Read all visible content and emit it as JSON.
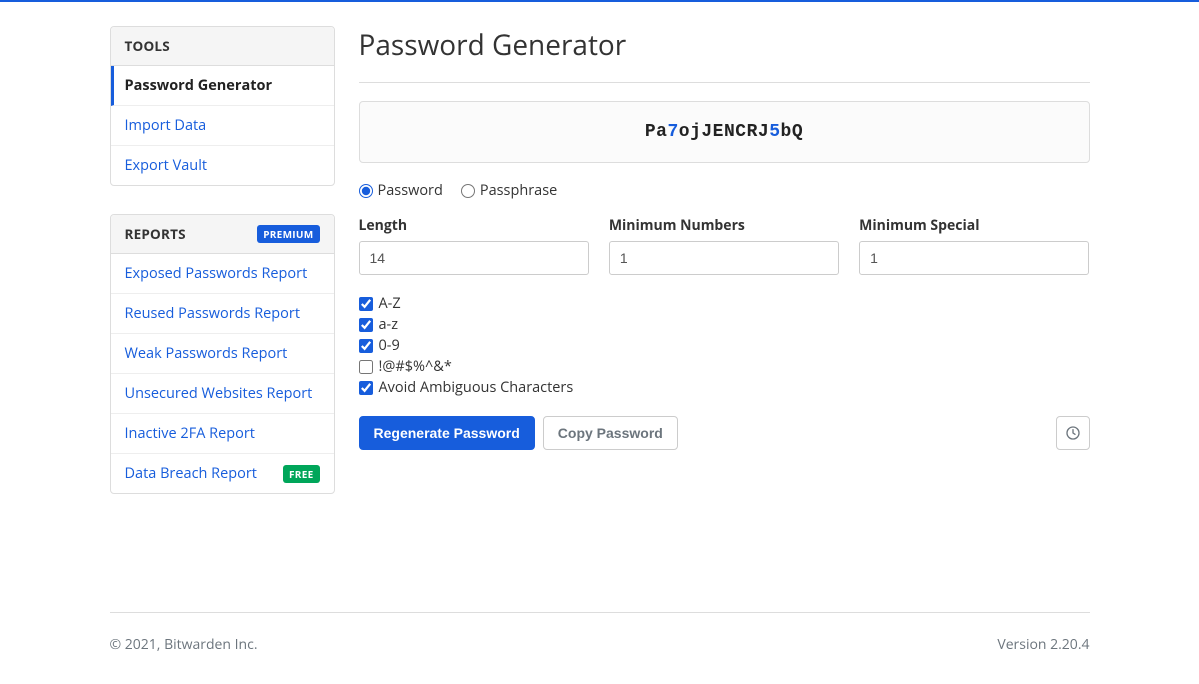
{
  "sidebar": {
    "tools": {
      "header": "TOOLS",
      "items": [
        {
          "label": "Password Generator",
          "active": true
        },
        {
          "label": "Import Data",
          "active": false
        },
        {
          "label": "Export Vault",
          "active": false
        }
      ]
    },
    "reports": {
      "header": "REPORTS",
      "badge": "PREMIUM",
      "items": [
        {
          "label": "Exposed Passwords Report"
        },
        {
          "label": "Reused Passwords Report"
        },
        {
          "label": "Weak Passwords Report"
        },
        {
          "label": "Unsecured Websites Report"
        },
        {
          "label": "Inactive 2FA Report"
        },
        {
          "label": "Data Breach Report",
          "badge": "FREE"
        }
      ]
    }
  },
  "page": {
    "title": "Password Generator",
    "password_segments": [
      {
        "text": "Pa",
        "type": "letter"
      },
      {
        "text": "7",
        "type": "number"
      },
      {
        "text": "ojJENCRJ",
        "type": "letter"
      },
      {
        "text": "5",
        "type": "number"
      },
      {
        "text": "bQ",
        "type": "letter"
      }
    ],
    "type_radio": {
      "password": "Password",
      "passphrase": "Passphrase",
      "selected": "password"
    },
    "fields": {
      "length": {
        "label": "Length",
        "value": "14"
      },
      "min_numbers": {
        "label": "Minimum Numbers",
        "value": "1"
      },
      "min_special": {
        "label": "Minimum Special",
        "value": "1"
      }
    },
    "checks": {
      "upper": {
        "label": "A-Z",
        "checked": true
      },
      "lower": {
        "label": "a-z",
        "checked": true
      },
      "digits": {
        "label": "0-9",
        "checked": true
      },
      "special": {
        "label": "!@#$%^&*",
        "checked": false
      },
      "avoid_ambiguous": {
        "label": "Avoid Ambiguous Characters",
        "checked": true
      }
    },
    "buttons": {
      "regenerate": "Regenerate Password",
      "copy": "Copy Password"
    }
  },
  "footer": {
    "copyright": "© 2021, Bitwarden Inc.",
    "version": "Version 2.20.4"
  }
}
